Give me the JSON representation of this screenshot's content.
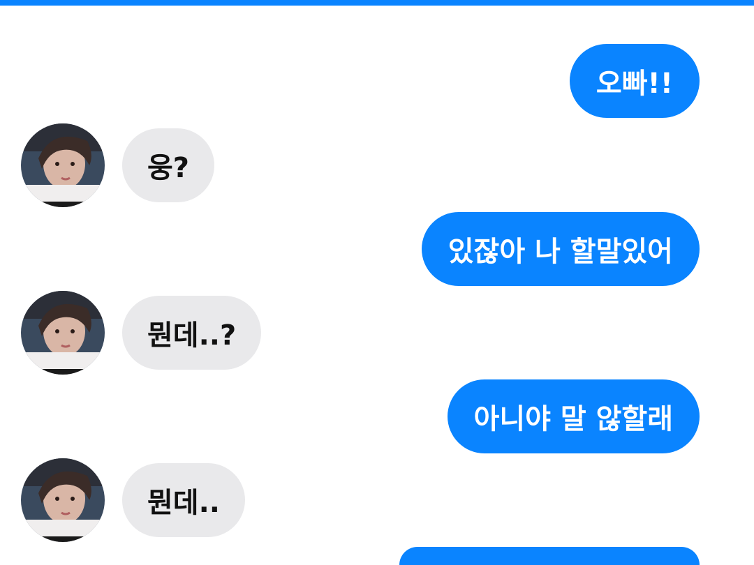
{
  "colors": {
    "accent": "#0a84ff",
    "sent_bubble": "#0a84ff",
    "received_bubble": "#e9e9eb",
    "top_bar": "#0a84ff"
  },
  "messages": [
    {
      "sender": "me",
      "text": "오빠!!"
    },
    {
      "sender": "other",
      "text": "웅?",
      "avatar": "profile-photo"
    },
    {
      "sender": "me",
      "text": "있잖아 나 할말있어"
    },
    {
      "sender": "other",
      "text": "뭔데..?",
      "avatar": "profile-photo"
    },
    {
      "sender": "me",
      "text": "아니야 말 않할래"
    },
    {
      "sender": "other",
      "text": "뭔데..",
      "avatar": "profile-photo"
    },
    {
      "sender": "me",
      "text": ""
    }
  ]
}
